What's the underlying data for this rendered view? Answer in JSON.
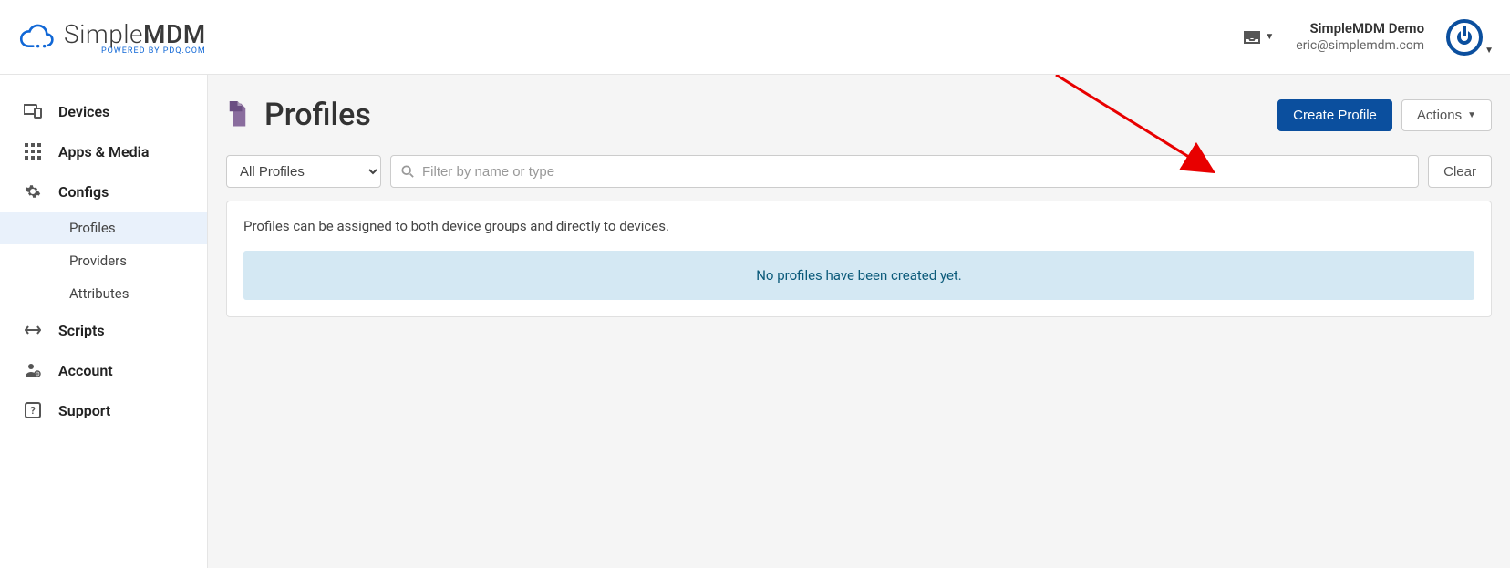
{
  "header": {
    "brand_main": "Simple",
    "brand_bold": "MDM",
    "brand_sub": "POWERED BY PDQ.COM",
    "user_name": "SimpleMDM Demo",
    "user_email": "eric@simplemdm.com"
  },
  "sidebar": {
    "items": [
      {
        "label": "Devices"
      },
      {
        "label": "Apps & Media"
      },
      {
        "label": "Configs"
      },
      {
        "label": "Scripts"
      },
      {
        "label": "Account"
      },
      {
        "label": "Support"
      }
    ],
    "config_subitems": [
      {
        "label": "Profiles"
      },
      {
        "label": "Providers"
      },
      {
        "label": "Attributes"
      }
    ]
  },
  "page": {
    "title": "Profiles",
    "create_label": "Create Profile",
    "actions_label": "Actions",
    "filter_select": "All Profiles",
    "filter_placeholder": "Filter by name or type",
    "clear_label": "Clear",
    "panel_note": "Profiles can be assigned to both device groups and directly to devices.",
    "empty_message": "No profiles have been created yet."
  }
}
